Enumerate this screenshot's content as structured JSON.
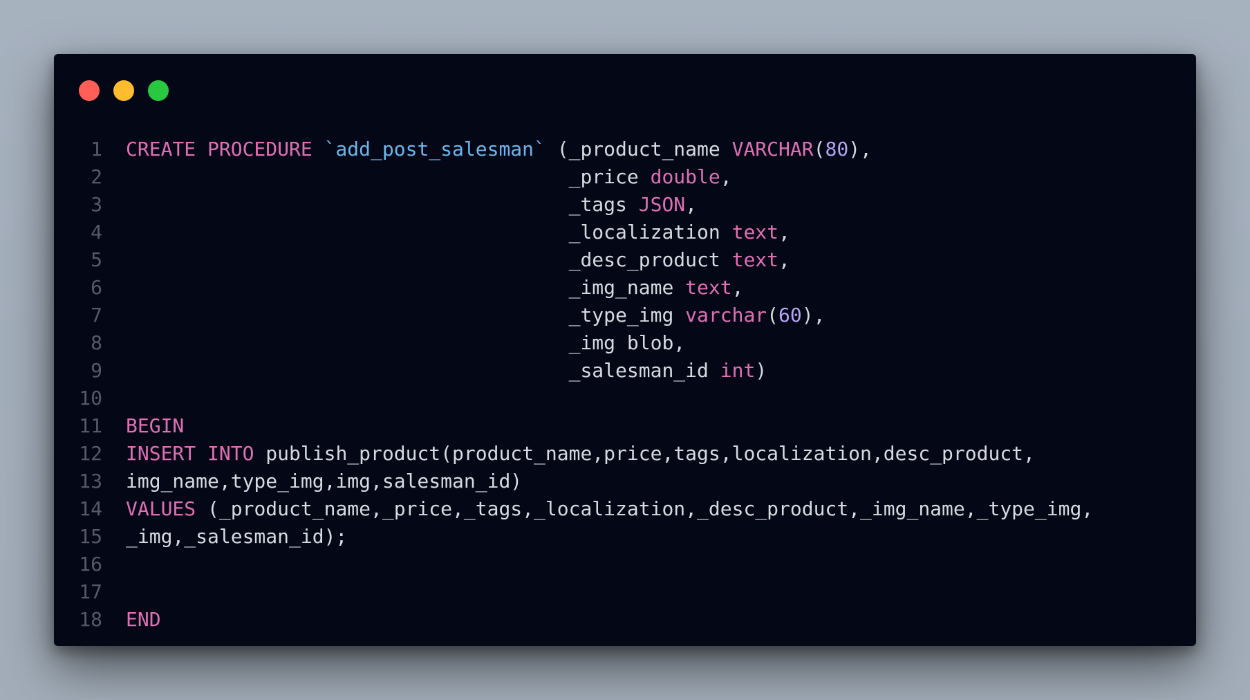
{
  "window": {
    "traffic_lights": [
      {
        "name": "close",
        "color": "#ff5f57"
      },
      {
        "name": "minimize",
        "color": "#febc2e"
      },
      {
        "name": "zoom",
        "color": "#28c840"
      }
    ]
  },
  "colors": {
    "background": "#a5b0bd",
    "editor_background": "#040816",
    "keyword": "#e06fb4",
    "identifier": "#6cb6ee",
    "number": "#b7a4f4",
    "plain_text": "#d7dae0",
    "line_number": "#545a6a"
  },
  "code": {
    "language": "sql",
    "lines": [
      {
        "number": "1",
        "tokens": [
          {
            "t": "CREATE PROCEDURE",
            "k": "kw"
          },
          {
            "t": " ",
            "k": "tx"
          },
          {
            "t": "`add_post_salesman`",
            "k": "id"
          },
          {
            "t": " (_product_name ",
            "k": "tx"
          },
          {
            "t": "VARCHAR",
            "k": "kw"
          },
          {
            "t": "(",
            "k": "tx"
          },
          {
            "t": "80",
            "k": "num"
          },
          {
            "t": "),",
            "k": "tx"
          }
        ]
      },
      {
        "number": "2",
        "tokens": [
          {
            "t": "                                      _price ",
            "k": "tx"
          },
          {
            "t": "double",
            "k": "kw"
          },
          {
            "t": ",",
            "k": "tx"
          }
        ]
      },
      {
        "number": "3",
        "tokens": [
          {
            "t": "                                      _tags ",
            "k": "tx"
          },
          {
            "t": "JSON",
            "k": "kw"
          },
          {
            "t": ",",
            "k": "tx"
          }
        ]
      },
      {
        "number": "4",
        "tokens": [
          {
            "t": "                                      _localization ",
            "k": "tx"
          },
          {
            "t": "text",
            "k": "kw"
          },
          {
            "t": ",",
            "k": "tx"
          }
        ]
      },
      {
        "number": "5",
        "tokens": [
          {
            "t": "                                      _desc_product ",
            "k": "tx"
          },
          {
            "t": "text",
            "k": "kw"
          },
          {
            "t": ",",
            "k": "tx"
          }
        ]
      },
      {
        "number": "6",
        "tokens": [
          {
            "t": "                                      _img_name ",
            "k": "tx"
          },
          {
            "t": "text",
            "k": "kw"
          },
          {
            "t": ",",
            "k": "tx"
          }
        ]
      },
      {
        "number": "7",
        "tokens": [
          {
            "t": "                                      _type_img ",
            "k": "tx"
          },
          {
            "t": "varchar",
            "k": "kw"
          },
          {
            "t": "(",
            "k": "tx"
          },
          {
            "t": "60",
            "k": "num"
          },
          {
            "t": "),",
            "k": "tx"
          }
        ]
      },
      {
        "number": "8",
        "tokens": [
          {
            "t": "                                      _img blob,",
            "k": "tx"
          }
        ]
      },
      {
        "number": "9",
        "tokens": [
          {
            "t": "                                      _salesman_id ",
            "k": "tx"
          },
          {
            "t": "int",
            "k": "kw"
          },
          {
            "t": ")",
            "k": "tx"
          }
        ]
      },
      {
        "number": "10",
        "tokens": []
      },
      {
        "number": "11",
        "tokens": [
          {
            "t": "BEGIN",
            "k": "kw"
          }
        ]
      },
      {
        "number": "12",
        "tokens": [
          {
            "t": "INSERT INTO",
            "k": "kw"
          },
          {
            "t": " publish_product(product_name,price,tags,localization,desc_product,",
            "k": "tx"
          }
        ]
      },
      {
        "number": "13",
        "tokens": [
          {
            "t": "img_name,type_img,img,salesman_id)",
            "k": "tx"
          }
        ]
      },
      {
        "number": "14",
        "tokens": [
          {
            "t": "VALUES",
            "k": "kw"
          },
          {
            "t": " (_product_name,_price,_tags,_localization,_desc_product,_img_name,_type_img,",
            "k": "tx"
          }
        ]
      },
      {
        "number": "15",
        "tokens": [
          {
            "t": "_img,_salesman_id);",
            "k": "tx"
          }
        ]
      },
      {
        "number": "16",
        "tokens": []
      },
      {
        "number": "17",
        "tokens": []
      },
      {
        "number": "18",
        "tokens": [
          {
            "t": "END",
            "k": "kw"
          }
        ]
      }
    ]
  }
}
